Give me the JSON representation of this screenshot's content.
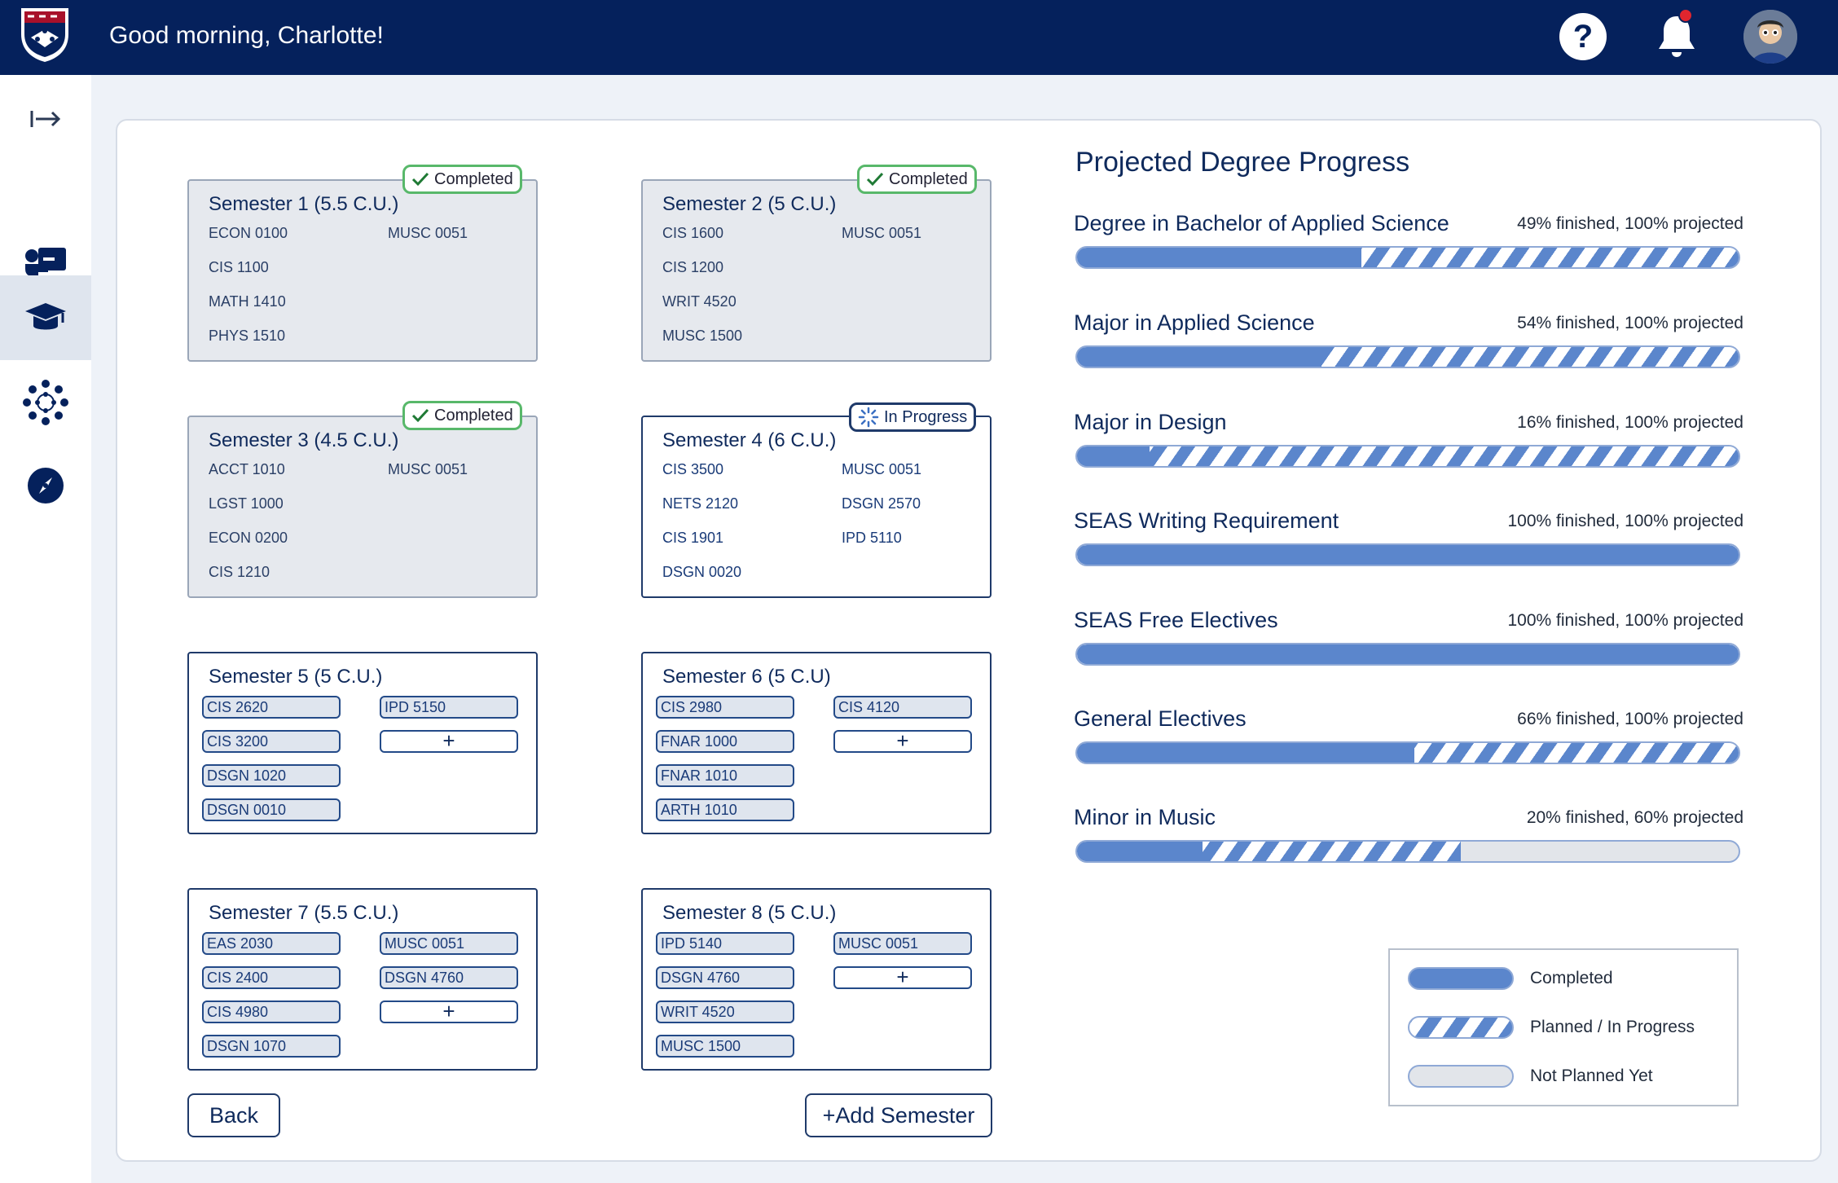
{
  "header": {
    "greeting": "Good morning, Charlotte!",
    "help_label": "?"
  },
  "sidebar": {
    "items": [
      {
        "icon": "expand-arrow-icon"
      },
      {
        "icon": "advisor-icon"
      },
      {
        "icon": "graduation-cap-icon"
      },
      {
        "icon": "canvas-icon"
      },
      {
        "icon": "compass-icon"
      }
    ]
  },
  "semesters": [
    {
      "title": "Semester 1  (5.5 C.U.)",
      "status": "Completed",
      "courses": [
        "ECON 0100",
        "CIS 1100",
        "MATH 1410",
        "PHYS 1510",
        "MUSC 0051"
      ]
    },
    {
      "title": "Semester 2  (5 C.U.)",
      "status": "Completed",
      "courses": [
        "CIS 1600",
        "CIS 1200",
        "WRIT 4520",
        "MUSC 1500",
        "MUSC 0051"
      ]
    },
    {
      "title": "Semester 3  (4.5 C.U.)",
      "status": "Completed",
      "courses": [
        "ACCT 1010",
        "LGST 1000",
        "ECON 0200",
        "CIS 1210",
        "MUSC 0051"
      ]
    },
    {
      "title": "Semester 4  (6 C.U.)",
      "status": "In Progress",
      "courses": [
        "CIS 3500",
        "NETS 2120",
        "CIS 1901",
        "DSGN 0020",
        "MUSC 0051",
        "DSGN 2570",
        "IPD 5110"
      ]
    },
    {
      "title": "Semester 5  (5 C.U.)",
      "courses": [
        "CIS 2620",
        "CIS 3200",
        "DSGN 1020",
        "DSGN 0010",
        "IPD 5150",
        "+"
      ]
    },
    {
      "title": "Semester 6  (5 C.U)",
      "courses": [
        "CIS 2980",
        "FNAR 1000",
        "FNAR 1010",
        "ARTH 1010",
        "CIS 4120",
        "+"
      ]
    },
    {
      "title": "Semester 7  (5.5 C.U.)",
      "courses": [
        "EAS 2030",
        "CIS 2400",
        "CIS 4980",
        "DSGN 1070",
        "MUSC 0051",
        "DSGN 4760",
        "+"
      ]
    },
    {
      "title": "Semester 8  (5 C.U.)",
      "courses": [
        "IPD 5140",
        "DSGN 4760",
        "WRIT 4520",
        "MUSC 1500",
        "MUSC 0051",
        "+"
      ]
    }
  ],
  "actions": {
    "back_label": "Back",
    "add_semester_label": "+Add Semester"
  },
  "progress": {
    "title": "Projected Degree Progress",
    "items": [
      {
        "name": "Degree in Bachelor of Applied Science",
        "stat": "49% finished, 100% projected",
        "finished": 0.43,
        "projected": 1.0
      },
      {
        "name": "Major in Applied Science",
        "stat": "54% finished, 100% projected",
        "finished": 0.37,
        "projected": 1.0
      },
      {
        "name": "Major in Design",
        "stat": "16% finished, 100% projected",
        "finished": 0.11,
        "projected": 1.0
      },
      {
        "name": "SEAS Writing Requirement",
        "stat": "100% finished, 100% projected",
        "finished": 1.0,
        "projected": 1.0
      },
      {
        "name": "SEAS Free Electives",
        "stat": "100% finished, 100% projected",
        "finished": 1.0,
        "projected": 1.0
      },
      {
        "name": "General Electives",
        "stat": "66% finished, 100% projected",
        "finished": 0.51,
        "projected": 1.0
      },
      {
        "name": "Minor in Music",
        "stat": "20% finished, 60% projected",
        "finished": 0.19,
        "projected": 0.58
      }
    ]
  },
  "legend": {
    "completed": "Completed",
    "planned": "Planned / In Progress",
    "not_planned": "Not Planned Yet"
  },
  "colors": {
    "navy": "#05215c",
    "completed_blue": "#5b86cc",
    "badge_green": "#58b86a",
    "not_planned_gray": "#e2e5ea"
  }
}
